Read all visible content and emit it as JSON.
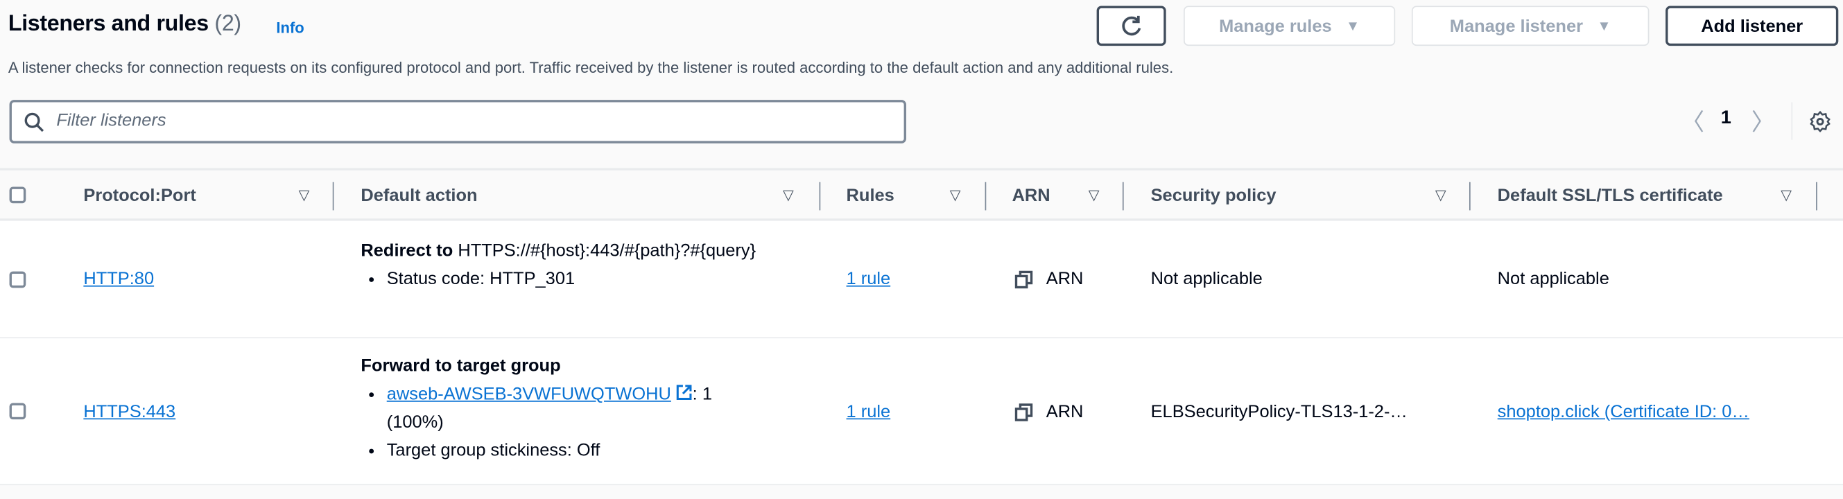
{
  "header": {
    "title": "Listeners and rules",
    "count": "(2)",
    "info": "Info",
    "description": "A listener checks for connection requests on its configured protocol and port. Traffic received by the listener is routed according to the default action and any additional rules."
  },
  "toolbar": {
    "manage_rules": "Manage rules",
    "manage_listener": "Manage listener",
    "add_listener": "Add listener"
  },
  "filter": {
    "placeholder": "Filter listeners",
    "value": ""
  },
  "pagination": {
    "page": "1"
  },
  "table": {
    "columns": [
      "Protocol:Port",
      "Default action",
      "Rules",
      "ARN",
      "Security policy",
      "Default SSL/TLS certificate"
    ],
    "rows": [
      {
        "protocol_port": "HTTP:80",
        "action_bold": "Redirect to",
        "action_text": " HTTPS://#{host}:443/#{path}?#{query}",
        "bullets": [
          "Status code: HTTP_301"
        ],
        "rules": "1 rule",
        "arn": "ARN",
        "security_policy": "Not applicable",
        "certificate": "Not applicable"
      },
      {
        "protocol_port": "HTTPS:443",
        "action_bold": "Forward to target group",
        "target_group": "awseb-AWSEB-3VWFUWQTWOHU",
        "target_weight": ": 1 (100%)",
        "bullets": [
          "Target group stickiness: Off"
        ],
        "rules": "1 rule",
        "arn": "ARN",
        "security_policy": "ELBSecurityPolicy-TLS13-1-2-…",
        "certificate": "shoptop.click (Certificate ID: 0…"
      }
    ]
  },
  "colors": {
    "link": "#0972d3",
    "text": "#000716",
    "disabled": "#9ba7b6"
  }
}
